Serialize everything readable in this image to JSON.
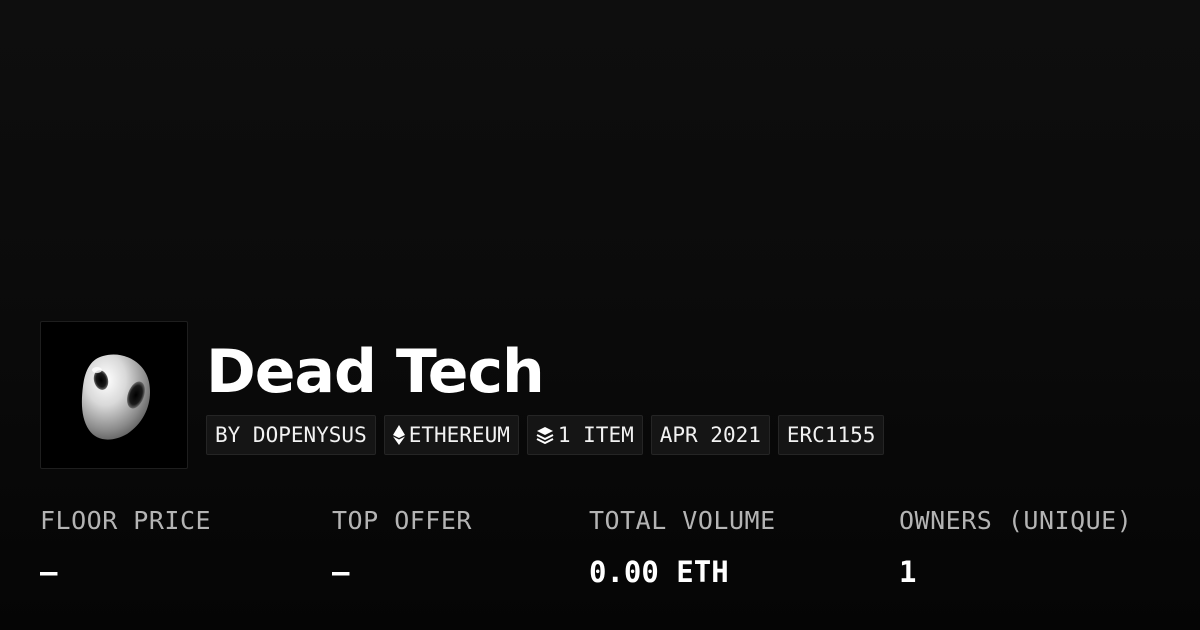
{
  "collection": {
    "name": "Dead Tech",
    "image_icon": "chrome-blob-artwork"
  },
  "tags": {
    "creator": "BY DOPENYSUS",
    "chain_icon": "ethereum-icon",
    "chain": "ETHEREUM",
    "items_icon": "stack-layers-icon",
    "items": "1 ITEM",
    "date": "APR 2021",
    "standard": "ERC1155"
  },
  "stats": {
    "floor_price": {
      "label": "FLOOR PRICE",
      "value": "—"
    },
    "top_offer": {
      "label": "TOP OFFER",
      "value": "—"
    },
    "total_volume": {
      "label": "TOTAL VOLUME",
      "value": "0.00 ETH"
    },
    "owners": {
      "label": "OWNERS (UNIQUE)",
      "value": "1"
    }
  },
  "colors": {
    "background": "#0b0b0b",
    "label": "#b4b4b4",
    "text": "#ffffff",
    "tag_bg": "#151515"
  }
}
